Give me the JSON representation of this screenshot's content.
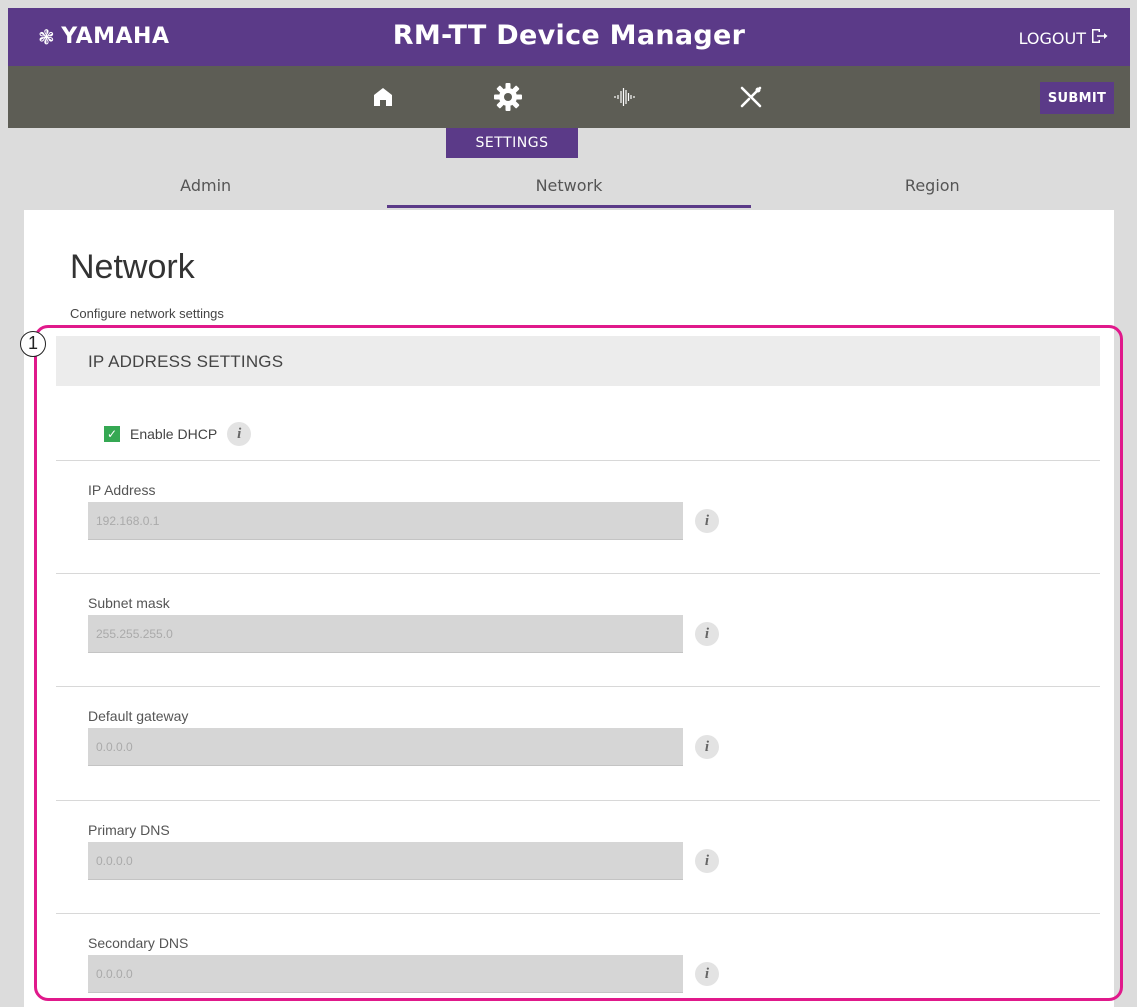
{
  "header": {
    "brand": "YAMAHA",
    "app_title": "RM-TT Device Manager",
    "logout_label": "LOGOUT"
  },
  "nav": {
    "items": [
      "home-icon",
      "gear-icon",
      "waveform-icon",
      "tools-icon"
    ],
    "submit_label": "SUBMIT",
    "active_label": "SETTINGS"
  },
  "tabs": [
    {
      "label": "Admin",
      "active": false
    },
    {
      "label": "Network",
      "active": true
    },
    {
      "label": "Region",
      "active": false
    }
  ],
  "page": {
    "title": "Network",
    "subtitle": "Configure network settings"
  },
  "section": {
    "title": "IP ADDRESS SETTINGS",
    "dhcp_label": "Enable DHCP",
    "dhcp_checked": true,
    "fields": [
      {
        "label": "IP Address",
        "value": "192.168.0.1"
      },
      {
        "label": "Subnet mask",
        "value": "255.255.255.0"
      },
      {
        "label": "Default gateway",
        "value": "0.0.0.0"
      },
      {
        "label": "Primary DNS",
        "value": "0.0.0.0"
      },
      {
        "label": "Secondary DNS",
        "value": "0.0.0.0"
      }
    ]
  },
  "annotation": {
    "number": "1",
    "color": "#e0198b"
  },
  "colors": {
    "primary": "#5b3a88",
    "nav_bg": "#5d5d55",
    "check_green": "#35a853"
  }
}
